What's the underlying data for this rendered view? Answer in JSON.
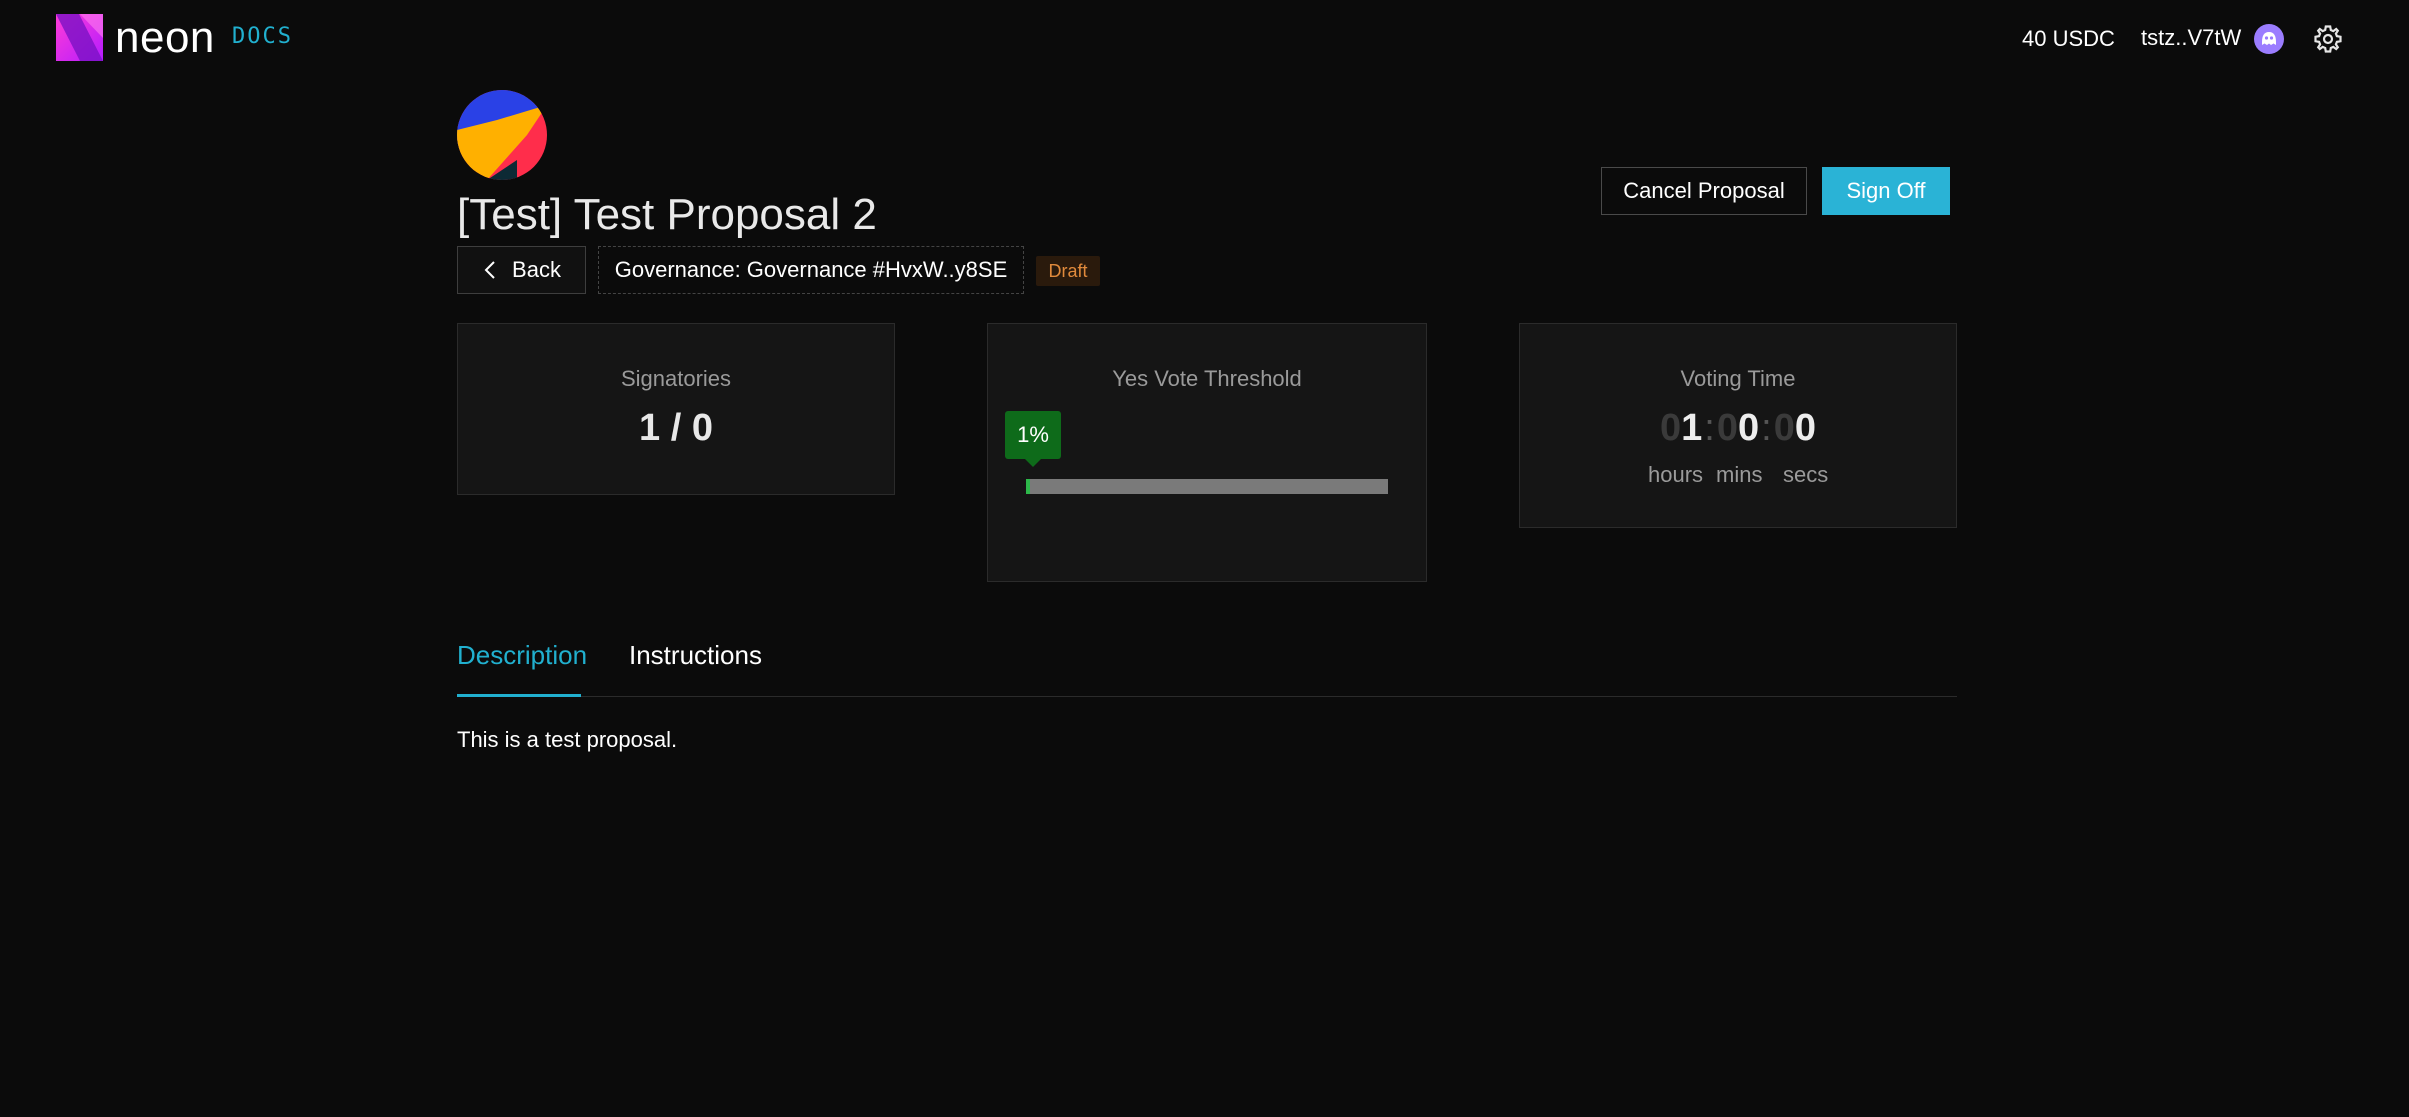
{
  "header": {
    "brand": "neon",
    "docs_label": "DOCS",
    "balance": "40 USDC",
    "wallet_address": "tstz..V7tW"
  },
  "proposal": {
    "title": "[Test] Test Proposal 2",
    "back_label": "Back",
    "governance_label": "Governance: Governance #HvxW..y8SE",
    "status_badge": "Draft",
    "cancel_label": "Cancel Proposal",
    "signoff_label": "Sign Off"
  },
  "stats": {
    "signatories": {
      "label": "Signatories",
      "value": "1 / 0"
    },
    "threshold": {
      "label": "Yes Vote Threshold",
      "percent_label": "1%",
      "percent": 1
    },
    "voting_time": {
      "label": "Voting Time",
      "hours_dim": "0",
      "hours_lit": "1",
      "mins_dim": "0",
      "mins_lit": "0",
      "secs_dim": "0",
      "secs_lit": "0",
      "sep": ":",
      "unit_hours": "hours",
      "unit_mins": "mins",
      "unit_secs": "secs"
    }
  },
  "tabs": [
    {
      "label": "Description",
      "active": true
    },
    {
      "label": "Instructions",
      "active": false
    }
  ],
  "description_text": "This is a test proposal.",
  "colors": {
    "accent": "#21b0cf",
    "primary_button": "#2ab3d6",
    "threshold_green": "#0e6b1a",
    "draft_text": "#e08a3c"
  },
  "icons": {
    "logo": "neon-logo-icon",
    "wallet_avatar": "ghost-avatar-icon",
    "settings": "gear-icon",
    "back": "chevron-left-icon"
  }
}
